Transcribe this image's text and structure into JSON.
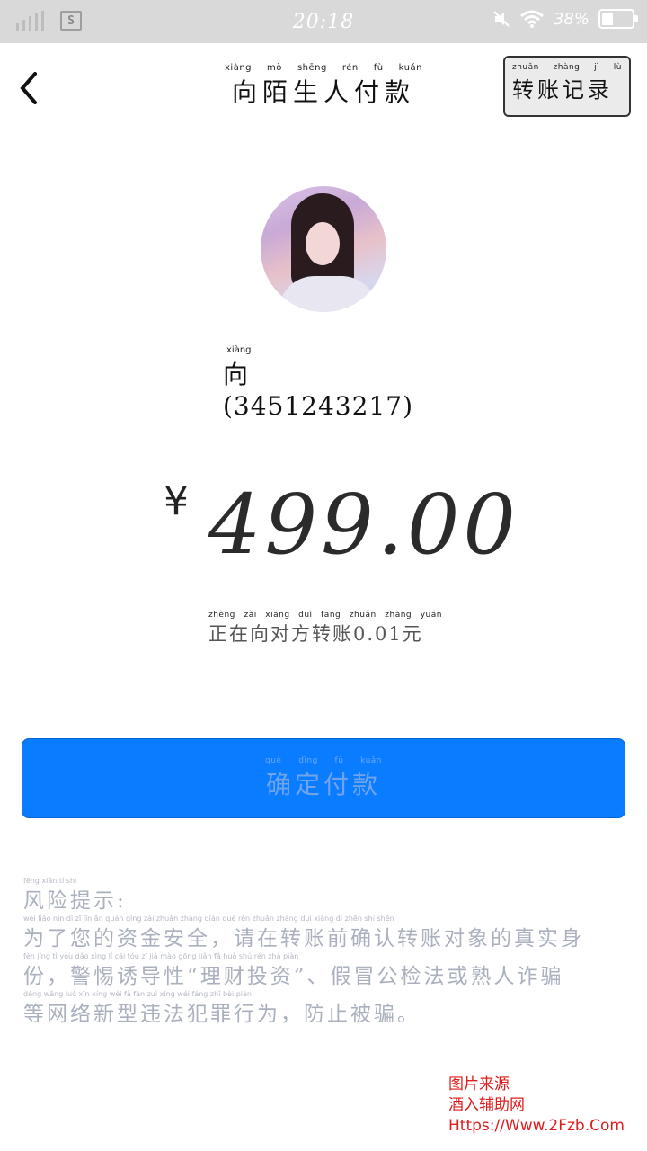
{
  "status_bar": {
    "time": "20:18",
    "battery_percent": "38%",
    "sim_label": "S"
  },
  "header": {
    "title_pinyin": [
      "xiàng",
      "mò",
      "shēng",
      "rén",
      "fù",
      "kuǎn"
    ],
    "title": "向陌生人付款",
    "records_pinyin": [
      "zhuǎn",
      "zhàng",
      "jì",
      "lù"
    ],
    "records_label": "转账记录"
  },
  "payee": {
    "name_pinyin": "xiàng",
    "name": "向(3451243217)"
  },
  "payment": {
    "currency_symbol": "¥",
    "amount": "499.00",
    "sub_pinyin": [
      "zhèng",
      "zài",
      "xiàng",
      "duì",
      "fāng",
      "zhuǎn",
      "zhàng",
      "",
      "",
      "",
      "yuán"
    ],
    "sub_text": "正在向对方转账0.01元"
  },
  "confirm": {
    "pinyin": [
      "què",
      "dìng",
      "fù",
      "kuǎn"
    ],
    "label": "确定付款"
  },
  "risk_tip": {
    "title_pinyin": "fēng  xiǎn  tí  shì",
    "title": "风险提示:",
    "lines_pinyin": [
      "wèi  liǎo  nín  dì  zī  jīn  ān  quán     qǐng  zài  zhuǎn  zhàng  qián  què  rèn  zhuǎn  zhàng  duì  xiàng  dì  zhēn  shí  shēn",
      "fèn    jǐng  tì  yòu  dǎo  xìng    lǐ  cái  tóu  zī     jiǎ  mào  gōng  jiǎn  fǎ  huò  shú  rén  zhà  piàn",
      "děng  wǎng  luò  xīn  xíng  wéi  fǎ  fàn  zuì  xíng  wéi     fáng  zhǐ  bèi  piàn"
    ],
    "lines": [
      "为了您的资金安全，请在转账前确认转账对象的真实身",
      "份，警惕诱导性“理财投资”、假冒公检法或熟人诈骗",
      "等网络新型违法犯罪行为，防止被骗。"
    ]
  },
  "watermark": {
    "line1": "图片来源",
    "line2": "酒入辅助网",
    "line3": "Https://Www.2Fzb.Com"
  }
}
